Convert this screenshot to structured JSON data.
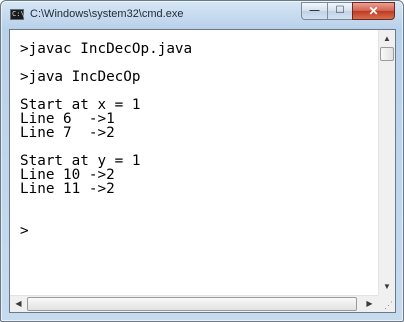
{
  "window": {
    "title": "C:\\Windows\\system32\\cmd.exe",
    "icon": "cmd-icon",
    "icon_glyph": "C:\\",
    "controls": {
      "minimize_glyph": "—",
      "maximize_glyph": "☐",
      "close_glyph": "✕"
    }
  },
  "console": {
    "lines": [
      ">javac IncDecOp.java",
      "",
      ">java IncDecOp",
      "",
      "Start at x = 1",
      "Line 6  ->1",
      "Line 7  ->2",
      "",
      "Start at y = 1",
      "Line 10 ->2",
      "Line 11 ->2",
      "",
      "",
      ">"
    ]
  },
  "scrollbars": {
    "up_arrow": "▲",
    "down_arrow": "▼",
    "left_arrow": "◀",
    "right_arrow": "▶",
    "grip": "⋰"
  }
}
